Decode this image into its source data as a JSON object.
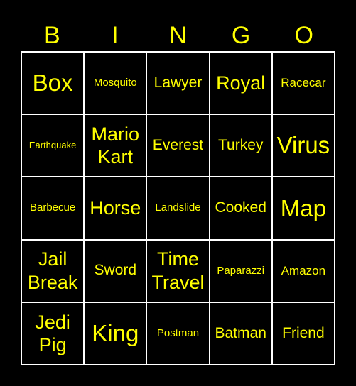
{
  "header": {
    "letters": [
      "B",
      "I",
      "N",
      "G",
      "O"
    ]
  },
  "colors": {
    "text": "#ffff00",
    "background": "#000000",
    "grid_lines": "#ffffff"
  },
  "card": {
    "rows": [
      [
        "Box",
        "Mosquito",
        "Lawyer",
        "Royal",
        "Racecar"
      ],
      [
        "Earthquake",
        "Mario Kart",
        "Everest",
        "Turkey",
        "Virus"
      ],
      [
        "Barbecue",
        "Horse",
        "Landslide",
        "Cooked",
        "Map"
      ],
      [
        "Jail Break",
        "Sword",
        "Time Travel",
        "Paparazzi",
        "Amazon"
      ],
      [
        "Jedi Pig",
        "King",
        "Postman",
        "Batman",
        "Friend"
      ]
    ]
  }
}
